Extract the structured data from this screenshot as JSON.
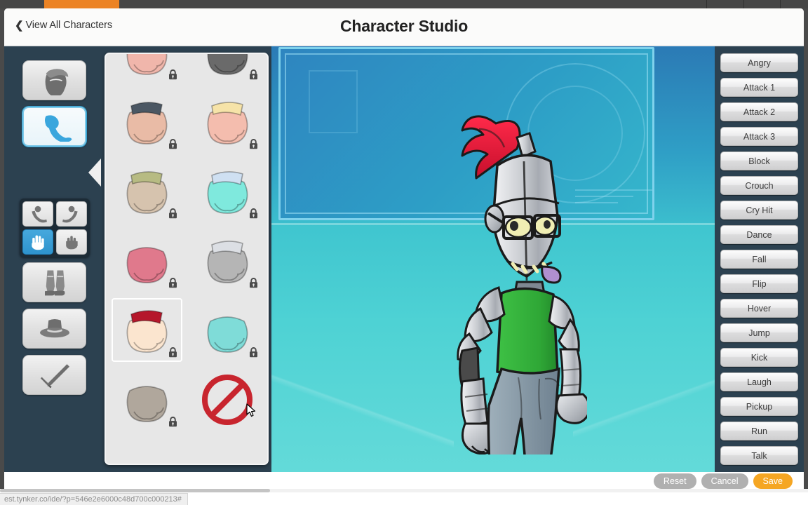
{
  "browser": {
    "status_url": "est.tynker.co/ide/?p=546e2e6000c48d700c000213#",
    "active_tab_color": "#ec8324"
  },
  "header": {
    "back_label": "View All Characters",
    "back_icon": "chevron-left-icon",
    "title": "Character Studio"
  },
  "part_rail": {
    "items": [
      {
        "id": "head",
        "icon": "head-icon",
        "selected": false
      },
      {
        "id": "arm",
        "icon": "arm-icon",
        "selected": true
      },
      {
        "id": "torso",
        "icon": "torso-icon",
        "selected": false
      },
      {
        "id": "legs",
        "icon": "legs-icon",
        "selected": false
      },
      {
        "id": "hat",
        "icon": "hat-icon",
        "selected": false
      },
      {
        "id": "sword",
        "icon": "sword-icon",
        "selected": false
      }
    ]
  },
  "subpart_panel": {
    "items": [
      {
        "id": "arm-left",
        "icon": "arm-left-icon",
        "selected": false
      },
      {
        "id": "arm-right",
        "icon": "arm-right-icon",
        "selected": false
      },
      {
        "id": "hand-open",
        "icon": "hand-open-icon",
        "selected": true
      },
      {
        "id": "hand-fist",
        "icon": "hand-fist-icon",
        "selected": false
      }
    ]
  },
  "item_grid": {
    "items": [
      {
        "id": "hand-pink",
        "kind": "hand",
        "color": "#f0b6ab",
        "accent": "",
        "locked": true,
        "selected": false
      },
      {
        "id": "hand-dark-gray",
        "kind": "hand",
        "color": "#6a6a6a",
        "accent": "",
        "locked": true,
        "selected": false
      },
      {
        "id": "hand-gauntlet",
        "kind": "hand",
        "color": "#e9bba6",
        "accent": "#4b5763",
        "locked": true,
        "selected": false
      },
      {
        "id": "hand-gold-cuff",
        "kind": "hand",
        "color": "#f4bdae",
        "accent": "#f6e3a8",
        "locked": true,
        "selected": false
      },
      {
        "id": "hand-olive-cuff",
        "kind": "hand",
        "color": "#d6c3ae",
        "accent": "#b7bb83",
        "locked": true,
        "selected": false
      },
      {
        "id": "hand-orb",
        "kind": "hand",
        "color": "#7fe9dd",
        "accent": "#cfe0f2",
        "locked": true,
        "selected": false
      },
      {
        "id": "hand-red",
        "kind": "hand",
        "color": "#e0798c",
        "accent": "",
        "locked": true,
        "selected": false
      },
      {
        "id": "hand-metal-box",
        "kind": "hand",
        "color": "#b5b5b5",
        "accent": "#dcdfe4",
        "locked": true,
        "selected": false
      },
      {
        "id": "hand-red-cuff",
        "kind": "hand",
        "color": "#fbe5cf",
        "accent": "#b5172b",
        "locked": true,
        "selected": true
      },
      {
        "id": "hand-cyan",
        "kind": "hand",
        "color": "#7fdcd8",
        "accent": "",
        "locked": true,
        "selected": false
      },
      {
        "id": "hand-taupe",
        "kind": "hand",
        "color": "#b0a79c",
        "accent": "",
        "locked": true,
        "selected": false
      },
      {
        "id": "hand-none",
        "kind": "none",
        "color": "#c8252e",
        "accent": "",
        "locked": false,
        "selected": false
      }
    ],
    "lock_icon": "padlock-icon",
    "none_icon": "no-entry-icon"
  },
  "actions": {
    "items": [
      "Angry",
      "Attack 1",
      "Attack 2",
      "Attack 3",
      "Block",
      "Crouch",
      "Cry Hit",
      "Dance",
      "Fall",
      "Flip",
      "Hover",
      "Jump",
      "Kick",
      "Laugh",
      "Pickup",
      "Run",
      "Talk"
    ]
  },
  "footer": {
    "reset_label": "Reset",
    "cancel_label": "Cancel",
    "save_label": "Save",
    "save_color": "#f5a623",
    "grey_color": "#b0b0b0"
  },
  "character": {
    "name": "knight-robot-avatar",
    "plume_color": "#e81e3c",
    "armor_color": "#c9ccd1",
    "shirt_color": "#33b13a",
    "jeans_color": "#8fa0ab",
    "tongue_color": "#b08fd0",
    "eye_color": "#f0eeb3"
  }
}
